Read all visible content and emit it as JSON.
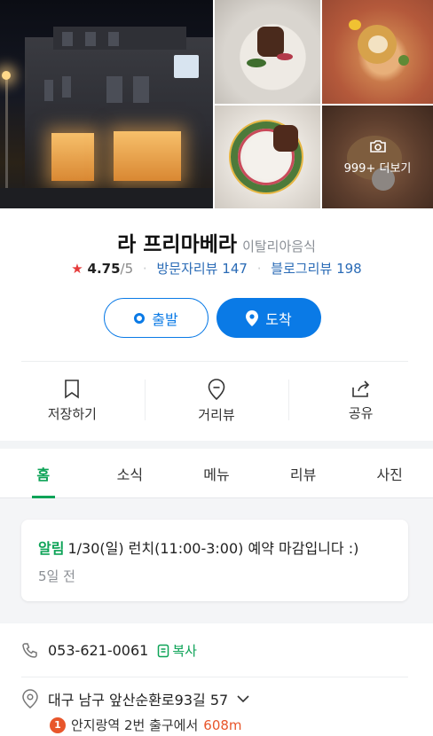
{
  "photos": {
    "more_label": "999+ 더보기"
  },
  "place": {
    "name": "라 프리마베라",
    "category": "이탈리아음식",
    "rating": "4.75",
    "rating_max": "/5",
    "visitor_reviews_label": "방문자리뷰",
    "visitor_reviews_count": "147",
    "blog_reviews_label": "블로그리뷰",
    "blog_reviews_count": "198"
  },
  "buttons": {
    "depart": "출발",
    "arrive": "도착"
  },
  "actions": [
    {
      "label": "저장하기",
      "icon": "bookmark-icon"
    },
    {
      "label": "거리뷰",
      "icon": "location-pin-icon"
    },
    {
      "label": "공유",
      "icon": "share-icon"
    }
  ],
  "tabs": [
    {
      "label": "홈",
      "active": true
    },
    {
      "label": "소식",
      "active": false
    },
    {
      "label": "메뉴",
      "active": false
    },
    {
      "label": "리뷰",
      "active": false
    },
    {
      "label": "사진",
      "active": false
    }
  ],
  "notice": {
    "tag": "알림",
    "text": "1/30(일) 런치(11:00-3:00) 예약 마감입니다 :)",
    "time": "5일 전"
  },
  "details": {
    "phone": "053-621-0061",
    "copy_label": "복사",
    "address": "대구 남구 앞산순환로93길 57",
    "subway_line_number": "1",
    "subway_directions": "안지랑역 2번 출구에서",
    "distance": "608m"
  },
  "colors": {
    "brand_blue": "#0a7ae6",
    "brand_green": "#0da357",
    "star_red": "#e53a3a",
    "line1_orange": "#e8562b"
  }
}
